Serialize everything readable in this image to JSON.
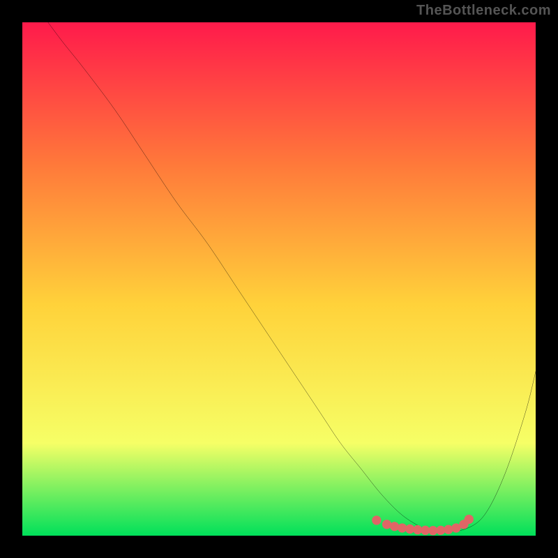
{
  "watermark": "TheBottleneck.com",
  "colors": {
    "gradient_top": "#ff1a4b",
    "gradient_mid_upper": "#ff7a3a",
    "gradient_mid": "#ffd23a",
    "gradient_mid_lower": "#f6ff66",
    "gradient_bottom": "#00e05a",
    "curve_stroke": "#000000",
    "accent_marker": "#e06666",
    "background": "#000000"
  },
  "chart_data": {
    "type": "line",
    "title": "",
    "xlabel": "",
    "ylabel": "",
    "xlim": [
      0,
      100
    ],
    "ylim": [
      0,
      100
    ],
    "grid": false,
    "legend": false,
    "series": [
      {
        "name": "curve",
        "x": [
          5,
          8,
          12,
          18,
          24,
          30,
          36,
          42,
          48,
          54,
          58,
          62,
          66,
          70,
          74,
          78,
          80,
          82,
          86,
          90,
          94,
          98,
          100
        ],
        "y": [
          100,
          96,
          91,
          83,
          74,
          65,
          57,
          48,
          39,
          30,
          24,
          18,
          13,
          8,
          4,
          1.5,
          1,
          1,
          1.2,
          4,
          12,
          24,
          32
        ]
      }
    ],
    "accent_markers": {
      "name": "low-region-dots",
      "x": [
        69,
        71,
        72.5,
        74,
        75.5,
        77,
        78.5,
        80,
        81.5,
        83,
        84.5,
        86,
        87
      ],
      "y": [
        3.0,
        2.2,
        1.8,
        1.5,
        1.3,
        1.15,
        1.05,
        1.0,
        1.05,
        1.2,
        1.5,
        2.2,
        3.2
      ]
    }
  }
}
